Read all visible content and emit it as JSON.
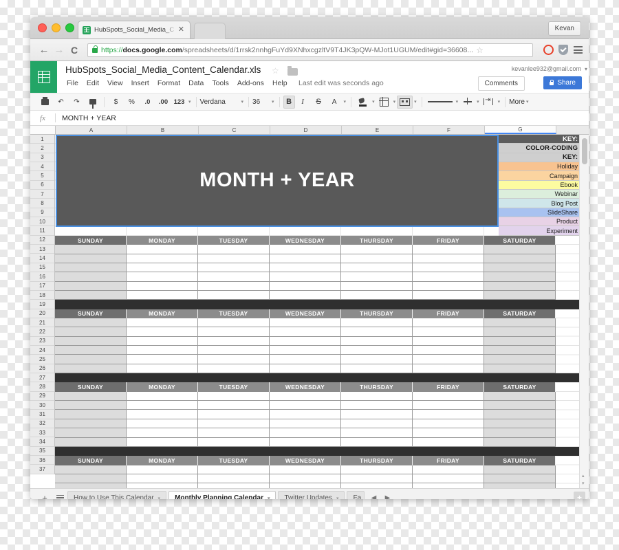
{
  "browser": {
    "tab_title": "HubSpots_Social_Media_C",
    "tab_close": "✕",
    "profile_label": "Kevan",
    "back_icon": "←",
    "forward_icon": "→",
    "reload_icon": "C",
    "url_scheme": "https://",
    "url_host": "docs.google.com",
    "url_path": "/spreadsheets/d/1rrsk2nnhgFuYd9XNhxcgzltV9T4JK3pQW-MJot1UGUM/edit#gid=36608...",
    "star_icon": "☆"
  },
  "app": {
    "doc_title": "HubSpots_Social_Media_Content_Calendar.xls",
    "menus": [
      "File",
      "Edit",
      "View",
      "Insert",
      "Format",
      "Data",
      "Tools",
      "Add-ons",
      "Help"
    ],
    "last_edit": "Last edit was seconds ago",
    "account_email": "kevanlee932@gmail.com",
    "account_caret": "▾",
    "comments_label": "Comments",
    "share_label": "Share"
  },
  "toolbar": {
    "undo_icon": "↶",
    "redo_icon": "↷",
    "currency": "$",
    "percent": "%",
    "dec_decrease": ".0",
    "dec_increase": ".00",
    "format_123": "123",
    "font_name": "Verdana",
    "font_size": "36",
    "bold": "B",
    "italic": "I",
    "strike": "S",
    "text_color": "A",
    "more_label": "More",
    "caret": "▾"
  },
  "formula_bar": {
    "fx_label": "fx",
    "value": "MONTH + YEAR"
  },
  "grid": {
    "columns": [
      "A",
      "B",
      "C",
      "D",
      "E",
      "F",
      "G"
    ],
    "selected_column": "G",
    "rows": [
      1,
      2,
      3,
      4,
      5,
      6,
      7,
      8,
      9,
      10,
      11,
      12,
      13,
      14,
      15,
      16,
      17,
      18,
      19,
      20,
      21,
      22,
      23,
      24,
      25,
      26,
      27,
      28,
      29,
      30,
      31,
      32,
      33,
      34,
      35,
      36,
      37
    ],
    "banner_text": "MONTH + YEAR",
    "banner_bg": "#595959",
    "banner_border": "#4a90e2",
    "key": {
      "title": "KEY:",
      "subtitle": "COLOR-CODING KEY:",
      "subtitle_line1": "COLOR-CODING",
      "subtitle_line2": "KEY:",
      "items": [
        {
          "label": "Holiday",
          "color": "#f8c390"
        },
        {
          "label": "Campaign",
          "color": "#fbd4a0"
        },
        {
          "label": "Ebook",
          "color": "#fdfba0"
        },
        {
          "label": "Webinar",
          "color": "#dceedc"
        },
        {
          "label": "Blog Post",
          "color": "#cfe6ea"
        },
        {
          "label": "SlideShare",
          "color": "#a8c2f0"
        },
        {
          "label": "Product",
          "color": "#e8d2e6"
        },
        {
          "label": "Experiment",
          "color": "#e2d3ec"
        }
      ]
    },
    "day_headers": [
      "SUNDAY",
      "MONDAY",
      "TUESDAY",
      "WEDNESDAY",
      "THURSDAY",
      "FRIDAY",
      "SATURDAY"
    ],
    "week_blocks": 4,
    "rows_per_week": 6,
    "separator_color": "#2f2f2f",
    "weekend_cell_color": "#dcdcdc",
    "dayheader_color": "#8c8c8c",
    "dayheader_weekend_color": "#6e6e6e"
  },
  "sheet_tabs": {
    "add_icon": "+",
    "all_sheets_icon": "sheet-list",
    "tabs": [
      {
        "label": "How to Use This Calendar",
        "active": false
      },
      {
        "label": "Monthly Planning Calendar",
        "active": true
      },
      {
        "label": "Twitter Updates",
        "active": false
      },
      {
        "label": "Fa",
        "active": false
      }
    ],
    "prev_icon": "◀",
    "next_icon": "▶",
    "caret": "▾"
  }
}
